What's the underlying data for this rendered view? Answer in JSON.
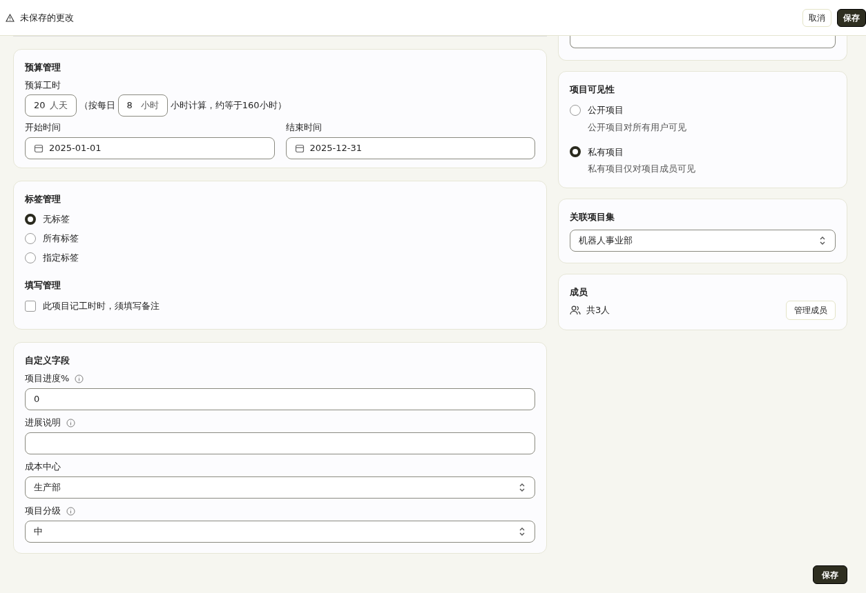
{
  "header": {
    "warning": "未保存的更改",
    "buttons": [
      {
        "label": "取消",
        "kind": "secondary"
      },
      {
        "label": "保存",
        "kind": "primary"
      }
    ]
  },
  "budget": {
    "title": "预算管理",
    "hours_label": "预算工时",
    "days_value": "20",
    "days_unit": "人天",
    "text_before": "（按每日",
    "hours_per_day": "8",
    "hours_unit": "小时",
    "text_after": "小时计算，约等于160小时）",
    "start_label": "开始时间",
    "start_value": "2025-01-01",
    "end_label": "结束时间",
    "end_value": "2025-12-31"
  },
  "tags": {
    "title": "标签管理",
    "options": [
      {
        "label": "无标签",
        "selected": true
      },
      {
        "label": "所有标签",
        "selected": false
      },
      {
        "label": "指定标签",
        "selected": false
      }
    ]
  },
  "fill": {
    "title": "填写管理",
    "checkbox": {
      "label": "此项目记工时时，须填写备注",
      "checked": false
    }
  },
  "custom_fields": {
    "title": "自定义字段",
    "fields": [
      {
        "label": "项目进度%",
        "info": true,
        "kind": "input",
        "value": "0"
      },
      {
        "label": "进展说明",
        "info": true,
        "kind": "input"
      },
      {
        "label": "成本中心",
        "info": false,
        "kind": "select",
        "value": "生产部"
      },
      {
        "label": "项目分级",
        "info": true,
        "kind": "select",
        "value": "中"
      }
    ]
  },
  "visibility": {
    "title": "项目可见性",
    "options": [
      {
        "label": "公开项目",
        "description": "公开项目对所有用户可见",
        "selected": false
      },
      {
        "label": "私有项目",
        "description": "私有项目仅对项目成员可见",
        "selected": true
      }
    ]
  },
  "project_set": {
    "title": "关联项目集",
    "value": "机器人事业部"
  },
  "members": {
    "title": "成员",
    "count": "共3人",
    "button": "管理成员"
  },
  "footer_button": "保存"
}
